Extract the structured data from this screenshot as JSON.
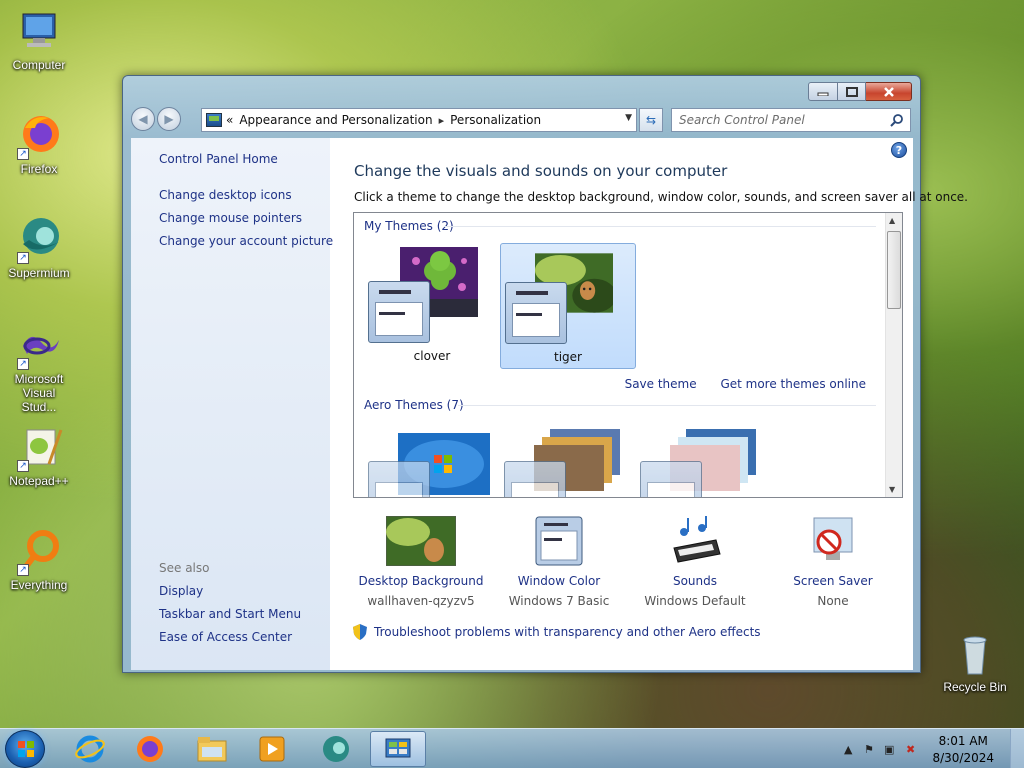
{
  "desktop": {
    "icons": [
      {
        "label": "Computer",
        "icon": "computer-icon"
      },
      {
        "label": "Firefox",
        "icon": "firefox-icon"
      },
      {
        "label": "Supermium",
        "icon": "supermium-icon"
      },
      {
        "label": "Microsoft Visual Stud...",
        "icon": "visual-studio-icon"
      },
      {
        "label": "Notepad++",
        "icon": "notepadpp-icon"
      },
      {
        "label": "Everything",
        "icon": "everything-icon"
      }
    ],
    "recycle_bin": {
      "label": "Recycle Bin",
      "icon": "recycle-bin-icon"
    }
  },
  "window": {
    "breadcrumb": {
      "chevrons": "«",
      "items": [
        "Appearance and Personalization",
        "Personalization"
      ],
      "separator": "▸"
    },
    "search_placeholder": "Search Control Panel",
    "left_pane": {
      "home": "Control Panel Home",
      "links": [
        "Change desktop icons",
        "Change mouse pointers",
        "Change your account picture"
      ],
      "see_also_label": "See also",
      "see_also": [
        "Display",
        "Taskbar and Start Menu",
        "Ease of Access Center"
      ]
    },
    "main": {
      "heading": "Change the visuals and sounds on your computer",
      "subheading": "Click a theme to change the desktop background, window color, sounds, and screen saver all at once.",
      "groups": {
        "my_themes_label": "My Themes (2)",
        "my_themes": [
          {
            "name": "clover",
            "selected": false
          },
          {
            "name": "tiger",
            "selected": true
          }
        ],
        "save_theme": "Save theme",
        "get_more": "Get more themes online",
        "aero_label": "Aero Themes (7)"
      },
      "bottom": [
        {
          "label": "Desktop Background",
          "value": "wallhaven-qzyzv5",
          "icon": "desktop-background-icon"
        },
        {
          "label": "Window Color",
          "value": "Windows 7 Basic",
          "icon": "window-color-icon"
        },
        {
          "label": "Sounds",
          "value": "Windows Default",
          "icon": "sounds-icon"
        },
        {
          "label": "Screen Saver",
          "value": "None",
          "icon": "screen-saver-icon"
        }
      ],
      "troubleshoot": "Troubleshoot problems with transparency and other Aero effects"
    }
  },
  "taskbar": {
    "pinned": [
      "internet-explorer-icon",
      "firefox-icon",
      "explorer-icon",
      "media-player-icon",
      "supermium-icon",
      "control-panel-icon"
    ],
    "time": "8:01 AM",
    "date": "8/30/2024"
  },
  "colors": {
    "link": "#1e3287",
    "heading": "#1e395b",
    "selected_theme_bg": "#c1dcfc"
  }
}
